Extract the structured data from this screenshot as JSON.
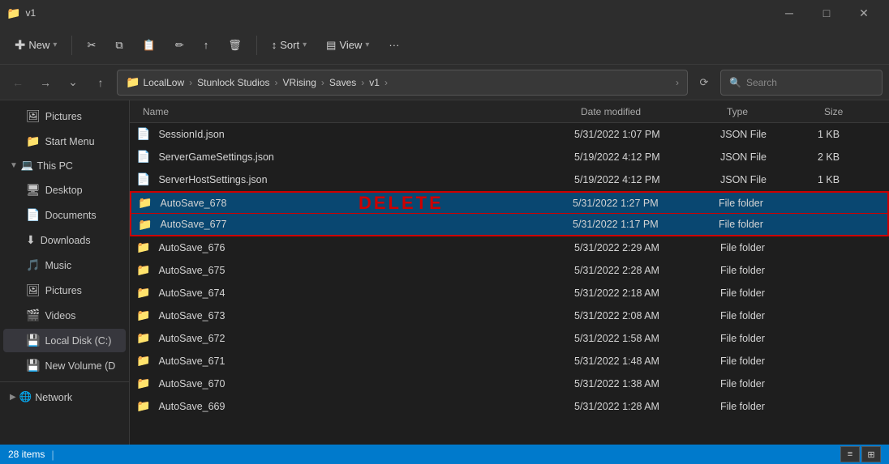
{
  "titlebar": {
    "title": "v1",
    "min_label": "─",
    "max_label": "□",
    "close_label": "✕"
  },
  "toolbar": {
    "new_label": "New",
    "cut_label": "✂",
    "copy_label": "⧉",
    "paste_label": "📋",
    "rename_label": "✏",
    "share_label": "↑",
    "delete_label": "🗑",
    "sort_label": "Sort",
    "view_label": "View",
    "more_label": "···"
  },
  "addressbar": {
    "parts": [
      "LocalLow",
      "Stunlock Studios",
      "VRising",
      "Saves",
      "v1"
    ],
    "search_placeholder": "Search"
  },
  "sidebar": {
    "items": [
      {
        "id": "pictures",
        "label": "Pictures",
        "icon": "🖼",
        "indent": true
      },
      {
        "id": "start-menu",
        "label": "Start Menu",
        "icon": "📁",
        "indent": true
      },
      {
        "id": "this-pc",
        "label": "This PC",
        "icon": "💻",
        "section": true
      },
      {
        "id": "desktop",
        "label": "Desktop",
        "icon": "🖥",
        "indent": true
      },
      {
        "id": "documents",
        "label": "Documents",
        "icon": "📄",
        "indent": true
      },
      {
        "id": "downloads",
        "label": "Downloads",
        "icon": "⬇",
        "indent": true
      },
      {
        "id": "music",
        "label": "Music",
        "icon": "🎵",
        "indent": true
      },
      {
        "id": "pictures2",
        "label": "Pictures",
        "icon": "🖼",
        "indent": true
      },
      {
        "id": "videos",
        "label": "Videos",
        "icon": "🎬",
        "indent": true
      },
      {
        "id": "local-disk",
        "label": "Local Disk (C:)",
        "icon": "💾",
        "indent": true
      },
      {
        "id": "new-volume",
        "label": "New Volume (D",
        "icon": "💾",
        "indent": true
      },
      {
        "id": "network",
        "label": "Network",
        "icon": "🌐",
        "section": true
      }
    ]
  },
  "file_list": {
    "columns": [
      "Name",
      "Date modified",
      "Type",
      "Size"
    ],
    "rows": [
      {
        "name": "SessionId.json",
        "date": "5/31/2022 1:07 PM",
        "type": "JSON File",
        "size": "1 KB",
        "icon": "json"
      },
      {
        "name": "ServerGameSettings.json",
        "date": "5/19/2022 4:12 PM",
        "type": "JSON File",
        "size": "2 KB",
        "icon": "json"
      },
      {
        "name": "ServerHostSettings.json",
        "date": "5/19/2022 4:12 PM",
        "type": "JSON File",
        "size": "1 KB",
        "icon": "json"
      },
      {
        "name": "AutoSave_678",
        "date": "5/31/2022 1:27 PM",
        "type": "File folder",
        "size": "",
        "icon": "folder",
        "selected": true
      },
      {
        "name": "AutoSave_677",
        "date": "5/31/2022 1:17 PM",
        "type": "File folder",
        "size": "",
        "icon": "folder",
        "selected": true
      },
      {
        "name": "AutoSave_676",
        "date": "5/31/2022 2:29 AM",
        "type": "File folder",
        "size": "",
        "icon": "folder"
      },
      {
        "name": "AutoSave_675",
        "date": "5/31/2022 2:28 AM",
        "type": "File folder",
        "size": "",
        "icon": "folder"
      },
      {
        "name": "AutoSave_674",
        "date": "5/31/2022 2:18 AM",
        "type": "File folder",
        "size": "",
        "icon": "folder"
      },
      {
        "name": "AutoSave_673",
        "date": "5/31/2022 2:08 AM",
        "type": "File folder",
        "size": "",
        "icon": "folder"
      },
      {
        "name": "AutoSave_672",
        "date": "5/31/2022 1:58 AM",
        "type": "File folder",
        "size": "",
        "icon": "folder"
      },
      {
        "name": "AutoSave_671",
        "date": "5/31/2022 1:48 AM",
        "type": "File folder",
        "size": "",
        "icon": "folder"
      },
      {
        "name": "AutoSave_670",
        "date": "5/31/2022 1:38 AM",
        "type": "File folder",
        "size": "",
        "icon": "folder"
      },
      {
        "name": "AutoSave_669",
        "date": "5/31/2022 1:28 AM",
        "type": "File folder",
        "size": "",
        "icon": "folder"
      }
    ],
    "delete_label": "DELETE"
  },
  "statusbar": {
    "count": "28 items"
  }
}
